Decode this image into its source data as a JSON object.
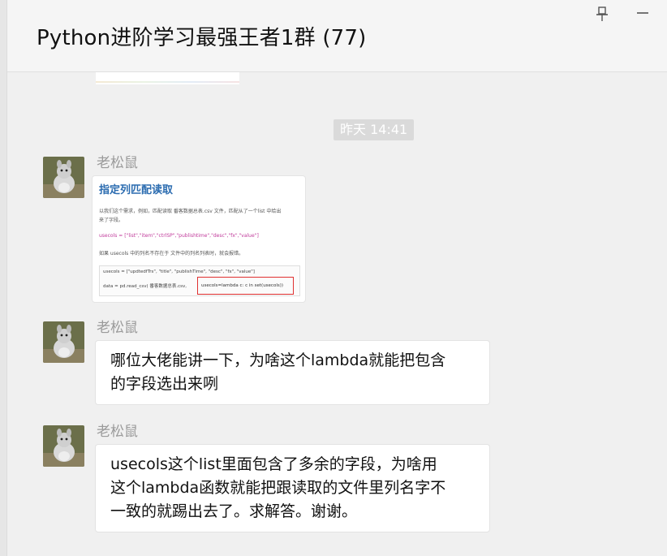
{
  "window": {
    "title": "Python进阶学习最强王者1群 (77)",
    "pin_icon": "pin-icon",
    "minimize_icon": "minimize-icon"
  },
  "timestamp": "昨天 14:41",
  "messages": [
    {
      "sender": "老松鼠",
      "type": "image",
      "image": {
        "doc_title": "指定列匹配读取",
        "lines": [
          "以我们这个需求，例如，匹配读取 番客数据总表.csv 文件，匹配从了一个list 中给出",
          "来了字段。",
          "usecols = [\"list\",\"item\",\"ctrlSP\",\"publishtime\",\"desc\",\"fx\",\"value\"]",
          "如果 usecols 中的列名不存在于 文件中的列名列表时，就会报错。"
        ],
        "code_lines": [
          "usecols = [\"updtedfTrs\", \"title\", \"publishTime\", \"desc\", \"fx\", \"value\"]",
          "data = pd.read_csv( 番客数据总表.csv,"
        ],
        "highlight": "usecols=lambda c: c in set(usecols))"
      }
    },
    {
      "sender": "老松鼠",
      "type": "text",
      "text": "哪位大佬能讲一下，为啥这个lambda就能把包含\n的字段选出来咧"
    },
    {
      "sender": "老松鼠",
      "type": "text",
      "text": "usecols这个list里面包含了多余的字段，为啥用\n这个lambda函数就能把跟读取的文件里列名字不\n一致的就踢出去了。求解答。谢谢。"
    }
  ]
}
